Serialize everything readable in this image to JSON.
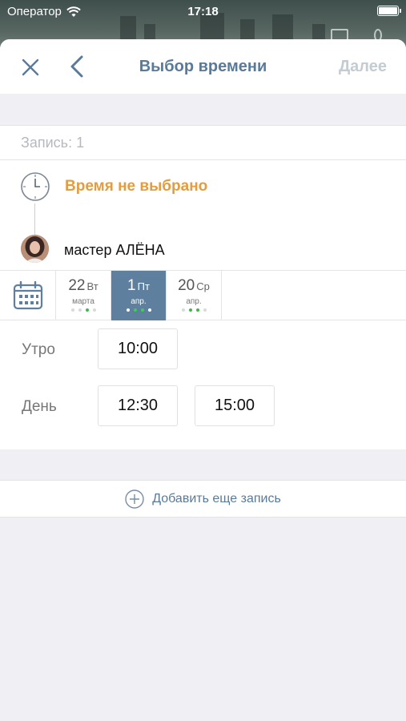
{
  "status_bar": {
    "carrier": "Оператор",
    "time": "17:18"
  },
  "nav": {
    "title": "Выбор времени",
    "next_label": "Далее"
  },
  "record": {
    "label": "Запись: 1",
    "status": "Время не выбрано",
    "master": "мастер АЛЁНА"
  },
  "dates": [
    {
      "day": "22",
      "weekday": "Вт",
      "month": "марта",
      "dots": [
        "grey",
        "grey",
        "green",
        "grey"
      ],
      "selected": false
    },
    {
      "day": "1",
      "weekday": "Пт",
      "month": "апр.",
      "dots": [
        "white",
        "green",
        "green",
        "white"
      ],
      "selected": true
    },
    {
      "day": "20",
      "weekday": "Ср",
      "month": "апр.",
      "dots": [
        "grey",
        "green",
        "green",
        "grey"
      ],
      "selected": false
    }
  ],
  "slots": {
    "morning": {
      "label": "Утро",
      "times": [
        "10:00"
      ]
    },
    "day": {
      "label": "День",
      "times": [
        "12:30",
        "15:00"
      ]
    }
  },
  "add_record": {
    "label": "Добавить еще запись"
  },
  "colors": {
    "accent": "#5f7f9e",
    "warning": "#e59c3e",
    "available": "#3cb94a"
  }
}
